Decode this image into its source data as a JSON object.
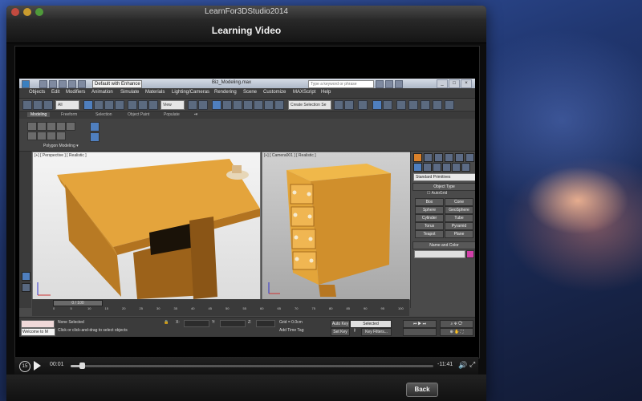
{
  "window": {
    "title": "LearnFor3DStudio2014"
  },
  "header": {
    "title": "Learning Video"
  },
  "max": {
    "workspace": "Default with Enhance",
    "filename": "Biz_Modeling.max",
    "search_placeholder": "Type a keyword or phrase",
    "menu": [
      "Objects",
      "Edit",
      "Modifiers",
      "Animation",
      "Simulate",
      "Materials",
      "Lighting/Cameras",
      "Rendering",
      "Scene",
      "Customize",
      "MAXScript",
      "Help"
    ],
    "toolbar": {
      "filter": "All",
      "view": "View",
      "selection_set": "Create Selection Se"
    },
    "ribbon_tabs": [
      "Modeling",
      "Freeform",
      "Selection",
      "Object Paint",
      "Populate"
    ],
    "ribbon_group": "Polygon Modeling",
    "viewport1_label": "[+] [ Perspective ] [ Realistic ]",
    "viewport2_label": "[+] [ Camera001 ] [ Realistic ]",
    "command_panel": {
      "dropdown": "Standard Primitives",
      "object_type": "Object Type",
      "autogrid": "AutoGrid",
      "primitives": [
        "Box",
        "Cone",
        "Sphere",
        "GeoSphere",
        "Cylinder",
        "Tube",
        "Torus",
        "Pyramid",
        "Teapot",
        "Plane"
      ],
      "name_and_color": "Name and Color"
    },
    "timeline": {
      "slider": "0 / 100",
      "ticks": [
        "0",
        "5",
        "10",
        "15",
        "20",
        "25",
        "30",
        "35",
        "40",
        "45",
        "50",
        "55",
        "60",
        "65",
        "70",
        "75",
        "80",
        "85",
        "90",
        "95",
        "100"
      ]
    },
    "status": {
      "welcome": "Welcome to M",
      "none_selected": "None Selected",
      "prompt": "Click or click-and-drag to select objects",
      "x_label": "X:",
      "y_label": "Y:",
      "z_label": "Z:",
      "grid": "Grid = 0.0cm",
      "add_time_tag": "Add Time Tag",
      "auto_key": "Auto Key",
      "set_key": "Set Key",
      "selected": "Selected",
      "key_filters": "Key Filters..."
    }
  },
  "player": {
    "elapsed": "00:01",
    "remaining": "-11:41",
    "progress": 0.03
  },
  "footer": {
    "back_label": "Back"
  }
}
